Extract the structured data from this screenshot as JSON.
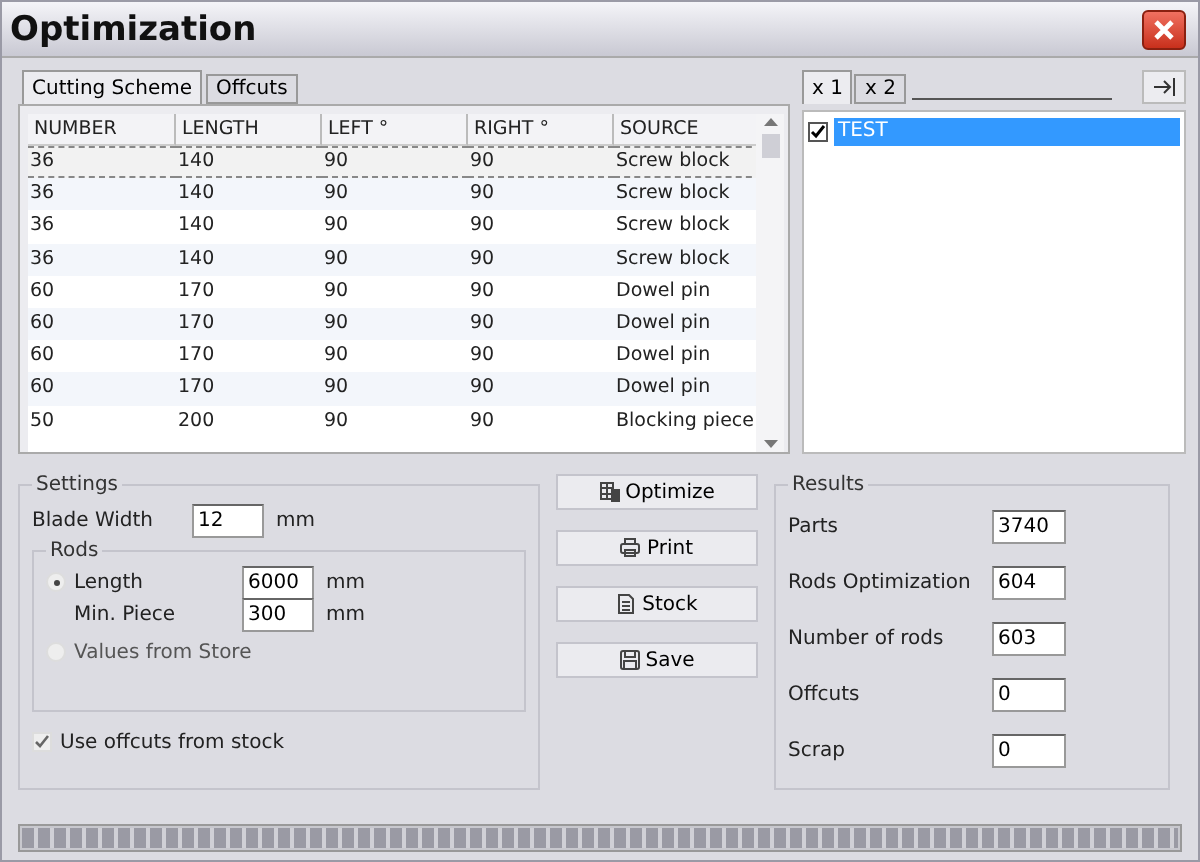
{
  "window": {
    "title": "Optimization"
  },
  "tabs": [
    {
      "label": "Cutting Scheme",
      "selected": true
    },
    {
      "label": "Offcuts",
      "selected": false
    }
  ],
  "table": {
    "columns": [
      "NUMBER",
      "LENGTH",
      "LEFT °",
      "RIGHT °",
      "SOURCE"
    ],
    "rows": [
      {
        "cells": [
          "36",
          "140",
          "90",
          "90",
          "Screw block"
        ],
        "selected": true
      },
      {
        "cells": [
          "36",
          "140",
          "90",
          "90",
          "Screw block"
        ],
        "selected": false
      },
      {
        "cells": [
          "36",
          "140",
          "90",
          "90",
          "Screw block"
        ],
        "selected": false
      },
      {
        "cells": [
          "36",
          "140",
          "90",
          "90",
          "Screw block"
        ],
        "selected": false
      },
      {
        "cells": [
          "60",
          "170",
          "90",
          "90",
          "Dowel pin"
        ],
        "selected": false
      },
      {
        "cells": [
          "60",
          "170",
          "90",
          "90",
          "Dowel pin"
        ],
        "selected": false
      },
      {
        "cells": [
          "60",
          "170",
          "90",
          "90",
          "Dowel pin"
        ],
        "selected": false
      },
      {
        "cells": [
          "60",
          "170",
          "90",
          "90",
          "Dowel pin"
        ],
        "selected": false
      },
      {
        "cells": [
          "50",
          "200",
          "90",
          "90",
          "Blocking piece"
        ],
        "selected": false
      }
    ]
  },
  "side_tabs": [
    {
      "label": "x 1",
      "selected": true
    },
    {
      "label": "x 2",
      "selected": false
    }
  ],
  "side_list": [
    {
      "label": "TEST",
      "checked": true,
      "selected": true
    }
  ],
  "settings": {
    "title": "Settings",
    "blade_width": {
      "label": "Blade Width",
      "value": "12",
      "unit": "mm"
    },
    "rods": {
      "title": "Rods",
      "options": [
        {
          "label": "Length",
          "selected": true
        },
        {
          "label": "Values from Store",
          "selected": false
        }
      ],
      "length": {
        "value": "6000",
        "unit": "mm"
      },
      "min_piece": {
        "label": "Min. Piece",
        "value": "300",
        "unit": "mm"
      }
    },
    "use_offcuts": {
      "label": "Use offcuts from stock",
      "checked": true
    }
  },
  "buttons": [
    {
      "label": "Optimize",
      "kind": "optimize"
    },
    {
      "label": "Print",
      "kind": "print"
    },
    {
      "label": "Stock",
      "kind": "stock"
    },
    {
      "label": "Save",
      "kind": "save"
    }
  ],
  "results": {
    "title": "Results",
    "items": [
      {
        "label": "Parts",
        "value": "3740"
      },
      {
        "label": "Rods Optimization",
        "value": "604"
      },
      {
        "label": "Number of rods",
        "value": "603"
      },
      {
        "label": "Offcuts",
        "value": "0"
      },
      {
        "label": "Scrap",
        "value": "0"
      }
    ]
  },
  "progress": {
    "level": 1
  }
}
